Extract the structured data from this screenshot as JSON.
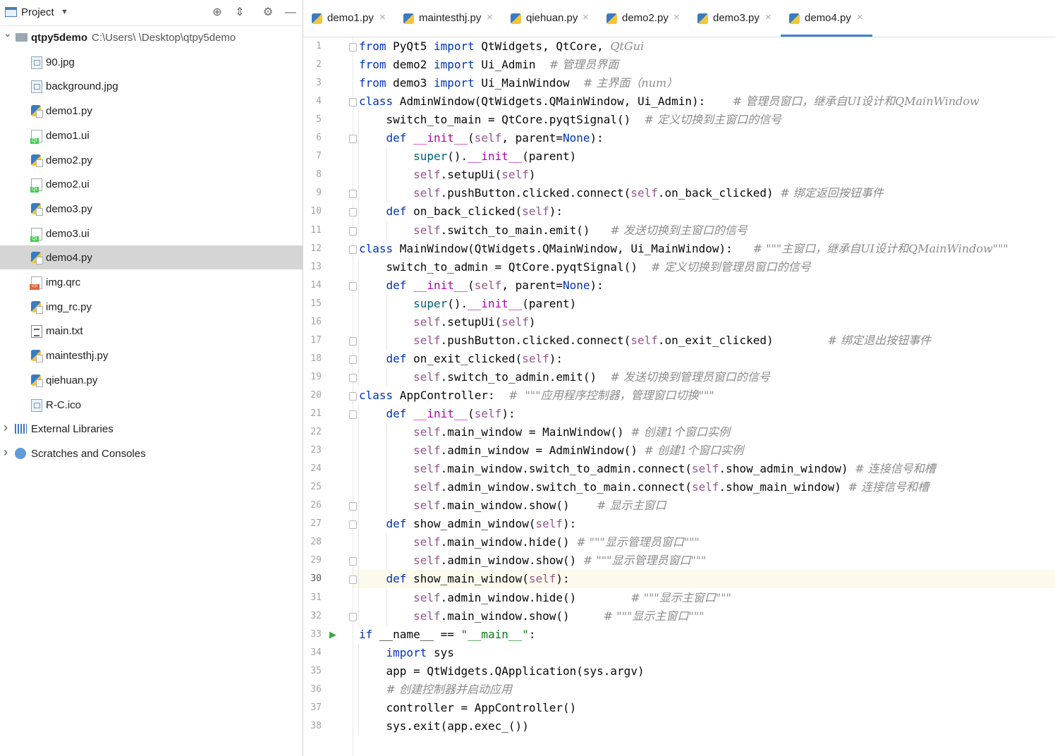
{
  "project_panel": {
    "title": "Project",
    "root": {
      "name": "qtpy5demo",
      "path": "C:\\Users\\        \\Desktop\\qtpy5demo"
    },
    "files": [
      {
        "name": "90.jpg",
        "icon": "image-file-icon",
        "kind": "img"
      },
      {
        "name": "background.jpg",
        "icon": "image-file-icon",
        "kind": "img"
      },
      {
        "name": "demo1.py",
        "icon": "python-file-icon",
        "kind": "py"
      },
      {
        "name": "demo1.ui",
        "icon": "qt-ui-file-icon",
        "kind": "ui"
      },
      {
        "name": "demo2.py",
        "icon": "python-file-icon",
        "kind": "py"
      },
      {
        "name": "demo2.ui",
        "icon": "qt-ui-file-icon",
        "kind": "ui"
      },
      {
        "name": "demo3.py",
        "icon": "python-file-icon",
        "kind": "py"
      },
      {
        "name": "demo3.ui",
        "icon": "qt-ui-file-icon",
        "kind": "ui"
      },
      {
        "name": "demo4.py",
        "icon": "python-file-icon",
        "kind": "py",
        "selected": true
      },
      {
        "name": "img.qrc",
        "icon": "qrc-file-icon",
        "kind": "qrc"
      },
      {
        "name": "img_rc.py",
        "icon": "python-file-icon",
        "kind": "py"
      },
      {
        "name": "main.txt",
        "icon": "text-file-icon",
        "kind": "txt"
      },
      {
        "name": "maintesthj.py",
        "icon": "python-file-icon",
        "kind": "py"
      },
      {
        "name": "qiehuan.py",
        "icon": "python-file-icon",
        "kind": "py"
      },
      {
        "name": "R-C.ico",
        "icon": "image-file-icon",
        "kind": "img"
      }
    ],
    "external_libraries": "External Libraries",
    "scratches": "Scratches and Consoles"
  },
  "tabs": [
    {
      "label": "demo1.py",
      "active": false
    },
    {
      "label": "maintesthj.py",
      "active": false
    },
    {
      "label": "qiehuan.py",
      "active": false
    },
    {
      "label": "demo2.py",
      "active": false
    },
    {
      "label": "demo3.py",
      "active": false
    },
    {
      "label": "demo4.py",
      "active": true
    }
  ],
  "editor": {
    "current_line": 30,
    "lines": [
      [
        [
          "kw",
          "from"
        ],
        [
          "nm",
          " PyQt5 "
        ],
        [
          "kw",
          "import"
        ],
        [
          "nm",
          " QtWidgets, QtCore, "
        ],
        [
          "cmt",
          "QtGui"
        ]
      ],
      [
        [
          "kw",
          "from"
        ],
        [
          "nm",
          " demo2 "
        ],
        [
          "kw",
          "import"
        ],
        [
          "nm",
          " Ui_Admin  "
        ],
        [
          "cmt",
          "# 管理员界面"
        ]
      ],
      [
        [
          "kw",
          "from"
        ],
        [
          "nm",
          " demo3 "
        ],
        [
          "kw",
          "import"
        ],
        [
          "nm",
          " Ui_MainWindow  "
        ],
        [
          "cmt",
          "# 主界面（num）"
        ]
      ],
      [
        [
          "kw",
          "class"
        ],
        [
          "nm",
          " AdminWindow(QtWidgets.QMainWindow, Ui_Admin):    "
        ],
        [
          "cmt",
          "# 管理员窗口，继承自UI设计和QMainWindow"
        ]
      ],
      [
        [
          "nm",
          "    switch_to_main = QtCore.pyqtSignal()  "
        ],
        [
          "cmt",
          "# 定义切换到主窗口的信号"
        ]
      ],
      [
        [
          "nm",
          "    "
        ],
        [
          "kw",
          "def"
        ],
        [
          "nm",
          " "
        ],
        [
          "dunder",
          "__init__"
        ],
        [
          "nm",
          "("
        ],
        [
          "self",
          "self"
        ],
        [
          "nm",
          ", parent="
        ],
        [
          "kw",
          "None"
        ],
        [
          "nm",
          "):"
        ]
      ],
      [
        [
          "nm",
          "        "
        ],
        [
          "fn",
          "super"
        ],
        [
          "nm",
          "()."
        ],
        [
          "dunder",
          "__init__"
        ],
        [
          "nm",
          "(parent)"
        ]
      ],
      [
        [
          "nm",
          "        "
        ],
        [
          "self",
          "self"
        ],
        [
          "nm",
          ".setupUi("
        ],
        [
          "self",
          "self"
        ],
        [
          "nm",
          ")"
        ]
      ],
      [
        [
          "nm",
          "        "
        ],
        [
          "self",
          "self"
        ],
        [
          "nm",
          ".pushButton.clicked.connect("
        ],
        [
          "self",
          "self"
        ],
        [
          "nm",
          ".on_back_clicked) "
        ],
        [
          "cmt",
          "# 绑定返回按钮事件"
        ]
      ],
      [
        [
          "nm",
          "    "
        ],
        [
          "kw",
          "def"
        ],
        [
          "nm",
          " on_back_clicked("
        ],
        [
          "self",
          "self"
        ],
        [
          "nm",
          "):"
        ]
      ],
      [
        [
          "nm",
          "        "
        ],
        [
          "self",
          "self"
        ],
        [
          "nm",
          ".switch_to_main.emit()   "
        ],
        [
          "cmt",
          "# 发送切换到主窗口的信号"
        ]
      ],
      [
        [
          "kw",
          "class"
        ],
        [
          "nm",
          " MainWindow(QtWidgets.QMainWindow, Ui_MainWindow):   "
        ],
        [
          "cmt",
          "# \"\"\"主窗口，继承自UI设计和QMainWindow\"\"\""
        ]
      ],
      [
        [
          "nm",
          "    switch_to_admin = QtCore.pyqtSignal()  "
        ],
        [
          "cmt",
          "# 定义切换到管理员窗口的信号"
        ]
      ],
      [
        [
          "nm",
          "    "
        ],
        [
          "kw",
          "def"
        ],
        [
          "nm",
          " "
        ],
        [
          "dunder",
          "__init__"
        ],
        [
          "nm",
          "("
        ],
        [
          "self",
          "self"
        ],
        [
          "nm",
          ", parent="
        ],
        [
          "kw",
          "None"
        ],
        [
          "nm",
          "):"
        ]
      ],
      [
        [
          "nm",
          "        "
        ],
        [
          "fn",
          "super"
        ],
        [
          "nm",
          "()."
        ],
        [
          "dunder",
          "__init__"
        ],
        [
          "nm",
          "(parent)"
        ]
      ],
      [
        [
          "nm",
          "        "
        ],
        [
          "self",
          "self"
        ],
        [
          "nm",
          ".setupUi("
        ],
        [
          "self",
          "self"
        ],
        [
          "nm",
          ")"
        ]
      ],
      [
        [
          "nm",
          "        "
        ],
        [
          "self",
          "self"
        ],
        [
          "nm",
          ".pushButton.clicked.connect("
        ],
        [
          "self",
          "self"
        ],
        [
          "nm",
          ".on_exit_clicked)        "
        ],
        [
          "cmt",
          "# 绑定退出按钮事件"
        ]
      ],
      [
        [
          "nm",
          "    "
        ],
        [
          "kw",
          "def"
        ],
        [
          "nm",
          " on_exit_clicked("
        ],
        [
          "self",
          "self"
        ],
        [
          "nm",
          "):"
        ]
      ],
      [
        [
          "nm",
          "        "
        ],
        [
          "self",
          "self"
        ],
        [
          "nm",
          ".switch_to_admin.emit()  "
        ],
        [
          "cmt",
          "# 发送切换到管理员窗口的信号"
        ]
      ],
      [
        [
          "kw",
          "class"
        ],
        [
          "nm",
          " AppController:  "
        ],
        [
          "cmt",
          "#  \"\"\"应用程序控制器，管理窗口切换\"\"\""
        ]
      ],
      [
        [
          "nm",
          "    "
        ],
        [
          "kw",
          "def"
        ],
        [
          "nm",
          " "
        ],
        [
          "dunder",
          "__init__"
        ],
        [
          "nm",
          "("
        ],
        [
          "self",
          "self"
        ],
        [
          "nm",
          "):"
        ]
      ],
      [
        [
          "nm",
          "        "
        ],
        [
          "self",
          "self"
        ],
        [
          "nm",
          ".main_window = MainWindow() "
        ],
        [
          "cmt",
          "# 创建1个窗口实例"
        ]
      ],
      [
        [
          "nm",
          "        "
        ],
        [
          "self",
          "self"
        ],
        [
          "nm",
          ".admin_window = AdminWindow() "
        ],
        [
          "cmt",
          "# 创建1个窗口实例"
        ]
      ],
      [
        [
          "nm",
          "        "
        ],
        [
          "self",
          "self"
        ],
        [
          "nm",
          ".main_window.switch_to_admin.connect("
        ],
        [
          "self",
          "self"
        ],
        [
          "nm",
          ".show_admin_window) "
        ],
        [
          "cmt",
          "# 连接信号和槽"
        ]
      ],
      [
        [
          "nm",
          "        "
        ],
        [
          "self",
          "self"
        ],
        [
          "nm",
          ".admin_window.switch_to_main.connect("
        ],
        [
          "self",
          "self"
        ],
        [
          "nm",
          ".show_main_window) "
        ],
        [
          "cmt",
          "# 连接信号和槽"
        ]
      ],
      [
        [
          "nm",
          "        "
        ],
        [
          "self",
          "self"
        ],
        [
          "nm",
          ".main_window.show()    "
        ],
        [
          "cmt",
          "# 显示主窗口"
        ]
      ],
      [
        [
          "nm",
          "    "
        ],
        [
          "kw",
          "def"
        ],
        [
          "nm",
          " show_admin_window("
        ],
        [
          "self",
          "self"
        ],
        [
          "nm",
          "):"
        ]
      ],
      [
        [
          "nm",
          "        "
        ],
        [
          "self",
          "self"
        ],
        [
          "nm",
          ".main_window.hide() "
        ],
        [
          "cmt",
          "# \"\"\"显示管理员窗口\"\"\""
        ]
      ],
      [
        [
          "nm",
          "        "
        ],
        [
          "self",
          "self"
        ],
        [
          "nm",
          ".admin_window.show() "
        ],
        [
          "cmt",
          "# \"\"\"显示管理员窗口\"\"\""
        ]
      ],
      [
        [
          "nm",
          "    "
        ],
        [
          "kw",
          "def"
        ],
        [
          "nm",
          " show_main_window("
        ],
        [
          "self",
          "self"
        ],
        [
          "nm",
          "):"
        ]
      ],
      [
        [
          "nm",
          "        "
        ],
        [
          "self",
          "self"
        ],
        [
          "nm",
          ".admin_window.hide()        "
        ],
        [
          "cmt",
          "# \"\"\"显示主窗口\"\"\""
        ]
      ],
      [
        [
          "nm",
          "        "
        ],
        [
          "self",
          "self"
        ],
        [
          "nm",
          ".main_window.show()     "
        ],
        [
          "cmt",
          "# \"\"\"显示主窗口\"\"\""
        ]
      ],
      [
        [
          "kw",
          "if"
        ],
        [
          "nm",
          " __name__ == "
        ],
        [
          "str",
          "\"__main__\""
        ],
        [
          "nm",
          ":"
        ]
      ],
      [
        [
          "nm",
          "    "
        ],
        [
          "kw",
          "import"
        ],
        [
          "nm",
          " sys"
        ]
      ],
      [
        [
          "nm",
          "    app = QtWidgets.QApplication(sys.argv)"
        ]
      ],
      [
        [
          "nm",
          "    "
        ],
        [
          "cmt",
          "# 创建控制器并启动应用"
        ]
      ],
      [
        [
          "nm",
          "    controller = AppController()"
        ]
      ],
      [
        [
          "nm",
          "    sys.exit(app.exec_())"
        ]
      ]
    ]
  }
}
